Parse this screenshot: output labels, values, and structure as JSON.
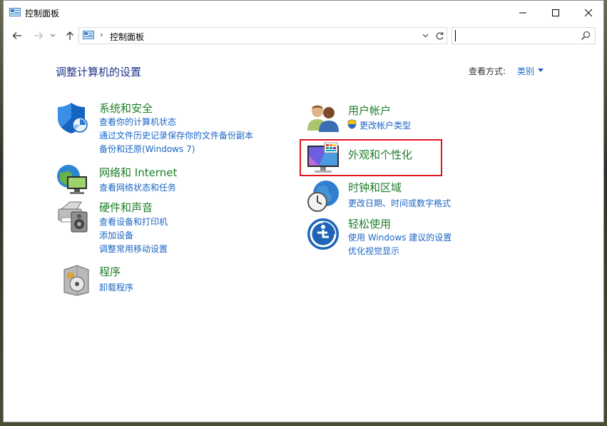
{
  "window": {
    "title": "控制面板",
    "buttons": {
      "minimize": "minimize",
      "maximize": "maximize",
      "close": "close"
    }
  },
  "navigation": {
    "address": {
      "separator": "›",
      "location": "控制面板"
    },
    "search": {
      "value": "",
      "placeholder": ""
    }
  },
  "header": {
    "title": "调整计算机的设置",
    "view_by_label": "查看方式:",
    "view_by_value": "类别"
  },
  "categories_left": [
    {
      "title": "系统和安全",
      "icon": "shield-icon",
      "links": [
        "查看你的计算机状态",
        "通过文件历史记录保存你的文件备份副本",
        "备份和还原(Windows 7)"
      ]
    },
    {
      "title": "网络和 Internet",
      "icon": "network-globe-icon",
      "links": [
        "查看网络状态和任务"
      ]
    },
    {
      "title": "硬件和声音",
      "icon": "printer-speaker-icon",
      "links": [
        "查看设备和打印机",
        "添加设备",
        "调整常用移动设置"
      ]
    },
    {
      "title": "程序",
      "icon": "programs-disc-icon",
      "links": [
        "卸载程序"
      ]
    }
  ],
  "categories_right": [
    {
      "title": "用户帐户",
      "icon": "users-icon",
      "links": [
        "更改帐户类型"
      ],
      "link_icon": "uac-shield-icon"
    },
    {
      "title": "外观和个性化",
      "icon": "monitor-palette-icon",
      "links": [],
      "highlighted": true
    },
    {
      "title": "时钟和区域",
      "icon": "clock-globe-icon",
      "links": [
        "更改日期、时间或数字格式"
      ]
    },
    {
      "title": "轻松使用",
      "icon": "ease-of-access-icon",
      "links": [
        "使用 Windows 建议的设置",
        "优化视觉显示"
      ]
    }
  ],
  "colors": {
    "heading": "#1e3287",
    "category_title": "#1e7e2a",
    "link": "#1a66c6",
    "highlight_border": "#e3141c"
  }
}
